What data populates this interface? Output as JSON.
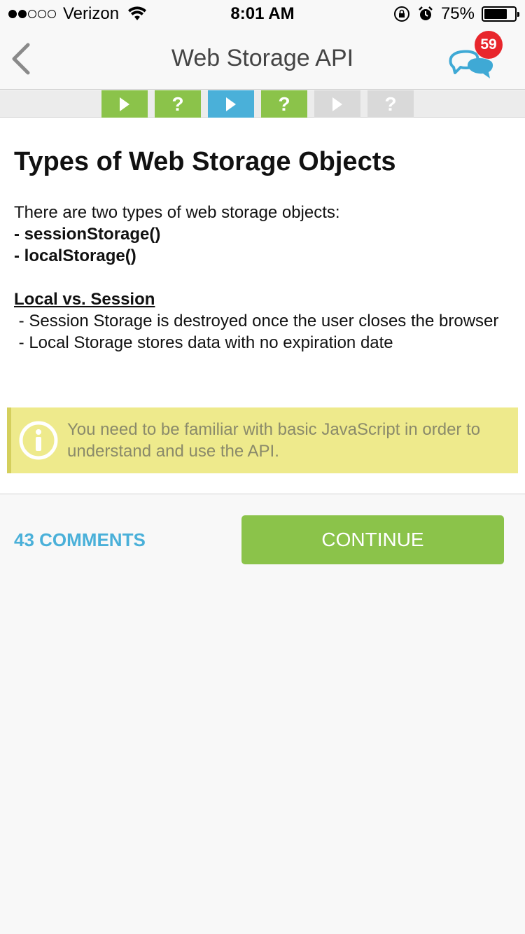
{
  "status_bar": {
    "carrier": "Verizon",
    "time": "8:01 AM",
    "battery": "75%",
    "battery_level": 0.75
  },
  "nav": {
    "title": "Web Storage API",
    "badge_count": "59",
    "back_icon": "chevron-left-icon",
    "chat_icon": "chat-bubbles-icon"
  },
  "progress": {
    "steps": [
      {
        "type": "play",
        "state": "done"
      },
      {
        "type": "quiz",
        "state": "done"
      },
      {
        "type": "play",
        "state": "current"
      },
      {
        "type": "quiz",
        "state": "done"
      },
      {
        "type": "play",
        "state": "locked"
      },
      {
        "type": "quiz",
        "state": "locked"
      }
    ]
  },
  "lesson": {
    "title": "Types of Web Storage Objects",
    "intro": "There are two types of web storage objects:",
    "item1": "- sessionStorage()",
    "item2": "- localStorage()",
    "section_heading": "Local vs. Session",
    "point1": " - Session Storage is destroyed once the user closes the browser",
    "point2": " - Local Storage stores data with no expiration date",
    "note": "You need to be familiar with basic JavaScript in order to understand and use the API."
  },
  "actions": {
    "comments_label": "43 COMMENTS",
    "continue_label": "CONTINUE"
  },
  "colors": {
    "green": "#8bc34a",
    "blue": "#4ab0d9",
    "badge_red": "#e8262c",
    "note_bg": "#eeea8c"
  }
}
